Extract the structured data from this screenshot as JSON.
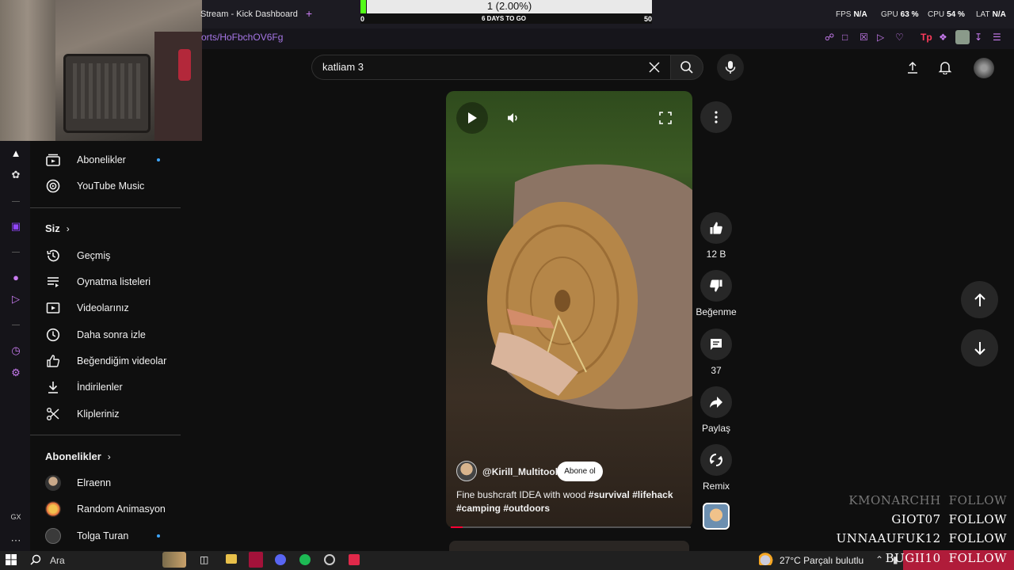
{
  "browser": {
    "tab_title": "Stream - Kick Dashboard",
    "tab_add": "+",
    "url": "orts/HoFbchOV6Fg",
    "stats": [
      {
        "label": "FPS",
        "value": "N/A"
      },
      {
        "label": "GPU",
        "value": "63 %"
      },
      {
        "label": "CPU",
        "value": "54 %"
      },
      {
        "label": "LAT",
        "value": "N/A"
      }
    ]
  },
  "goal": {
    "text": "1 (2.00%)",
    "progress": 0.02,
    "start": "0",
    "days": "6 DAYS TO GO",
    "end": "50",
    "color": "#53fc18"
  },
  "search": {
    "query": "katliam 3"
  },
  "sidebar": {
    "top_items": [
      {
        "label": "Abonelikler",
        "icon": "subscriptions-icon",
        "dot": true
      },
      {
        "label": "YouTube Music",
        "icon": "youtube-music-icon",
        "dot": false
      }
    ],
    "you_header": "Siz",
    "you_items": [
      {
        "label": "Geçmiş",
        "icon": "history-icon"
      },
      {
        "label": "Oynatma listeleri",
        "icon": "playlists-icon"
      },
      {
        "label": "Videolarınız",
        "icon": "your-videos-icon"
      },
      {
        "label": "Daha sonra izle",
        "icon": "watch-later-icon"
      },
      {
        "label": "Beğendiğim videolar",
        "icon": "liked-videos-icon"
      },
      {
        "label": "İndirilenler",
        "icon": "downloads-icon"
      },
      {
        "label": "Klipleriniz",
        "icon": "clips-icon"
      }
    ],
    "subs_header": "Abonelikler",
    "subs": [
      {
        "label": "Elraenn",
        "dot": false
      },
      {
        "label": "Random Animasyon",
        "dot": false
      },
      {
        "label": "Tolga Turan",
        "dot": true
      }
    ]
  },
  "short": {
    "channel": "@Kirill_Multitool",
    "subscribe": "Abone ol",
    "caption_text": "Fine bushcraft IDEA with wood",
    "caption_tags_1": "#survival #lifehack",
    "caption_tags_2": "#camping #outdoors",
    "progress": 0.05
  },
  "actions": {
    "likes": "12 B",
    "dislike": "Beğenme",
    "comments": "37",
    "share": "Paylaş",
    "remix": "Remix"
  },
  "follow_alerts": [
    {
      "user": "KMONARCHH",
      "action": "FOLLOW",
      "color": "#777777"
    },
    {
      "user": "GIOT07",
      "action": "FOLLOW",
      "color": "#ffffff"
    },
    {
      "user": "UNNAAUFUK12",
      "action": "FOLLOW",
      "color": "#ffffff"
    },
    {
      "user": "BUGII10",
      "action": "FOLLOW",
      "color": "#ffffff"
    }
  ],
  "taskbar": {
    "search": "Ara",
    "weather": "27°C  Parçalı bulutlu"
  },
  "colors": {
    "accent_blue": "#3ea6ff",
    "kick_green": "#53fc18",
    "follow_bg": "#b01c3a"
  }
}
